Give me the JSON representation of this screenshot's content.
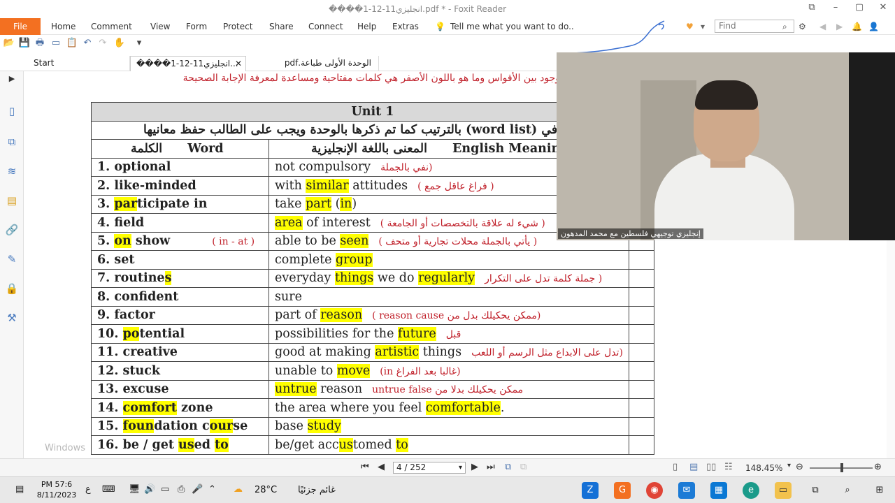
{
  "window": {
    "title": "����انجليزي11-12-1.pdf * - Foxit Reader"
  },
  "menu": {
    "file": "File",
    "items": [
      "Home",
      "Comment",
      "View",
      "Form",
      "Protect",
      "Share",
      "Connect",
      "Help",
      "Extras"
    ],
    "tell_me": "Tell me what you want to do..",
    "find_placeholder": "Find"
  },
  "tabs": {
    "start": "Start",
    "doc1": "����انجليزي11-12-1...",
    "doc2": "الوحدة الأولى طباعة.pdf"
  },
  "document": {
    "instruction": "هو موجود بين الأقواس وما هو باللون الأصفر هي كلمات مفتاحية ومساعدة لمعرفة الإجابة الصحيحة",
    "unit_title": "Unit 1",
    "note": "تم ذكره في (word list) بالترتيب كما تم ذكرها بالوحدة ويجب على الطالب حفظ معانيها",
    "header": {
      "word_ar": "الكلمة",
      "word_en": "Word",
      "meaning_ar": "المعنى باللغة الإنجليزية",
      "meaning_en": "English Meaning"
    },
    "watermark": "Windows"
  },
  "rows": [
    {
      "word": "1. optional",
      "meaning": "not compulsory",
      "note": "(نفي بالجملة"
    },
    {
      "word": "2. like-minded",
      "meaning": "with similar attitudes",
      "note": "( فراغ عاقل جمع )"
    },
    {
      "word": "3. participate in",
      "meaning": "take part (in)",
      "note": ""
    },
    {
      "word": "4. field",
      "meaning": "area of interest",
      "note": "( شيء له علاقة بالتخصصات أو الجامعة )"
    },
    {
      "word": "5. on show",
      "extra": "( in - at )",
      "meaning": "able to be seen",
      "note": "( يأتي بالجملة محلات تجارية أو متحف )"
    },
    {
      "word": "6. set",
      "meaning": "complete group",
      "note": ""
    },
    {
      "word": "7. routines",
      "meaning": "everyday things we do regularly",
      "note": "( جملة كلمة تدل على التكرار"
    },
    {
      "word": "8. confident",
      "meaning": "sure",
      "note": ""
    },
    {
      "word": "9. factor",
      "meaning": "part of reason",
      "note": "(ممكن يحكيلك بدل من reason cause )"
    },
    {
      "word": "10. potential",
      "meaning": "possibilities for the future",
      "note": "قبل"
    },
    {
      "word": "11. creative",
      "meaning": "good at making artistic things",
      "note": "(تدل على الابداع مثل الرسم أو اللعب"
    },
    {
      "word": "12. stuck",
      "meaning": "unable to move",
      "note": "(غالبا بعد الفراغ in)"
    },
    {
      "word": "13. excuse",
      "meaning": "untrue reason",
      "note": "ممكن يحكيلك بدلا من untrue false"
    },
    {
      "word": "14. comfort zone",
      "meaning": "the area where you feel comfortable.",
      "note": ""
    },
    {
      "word": "15. foundation course",
      "meaning": "base study",
      "note": ""
    },
    {
      "word": "16. be / get used to",
      "meaning": "be/get accustomed to",
      "note": ""
    }
  ],
  "webcam": {
    "caption": "إنجليزي توجيهي فلسطين مع محمد المدهون"
  },
  "status": {
    "page": "4 / 252",
    "zoom": "148.45%"
  },
  "taskbar": {
    "time": "PM 57:6",
    "date": "8/11/2023",
    "lang": "ع",
    "temperature": "28°C",
    "weather": "غائم جزئيًا"
  }
}
